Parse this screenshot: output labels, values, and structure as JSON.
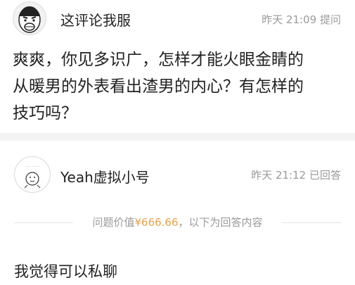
{
  "question": {
    "avatar_icon": "rage-face-avatar-icon",
    "username": "这评论我服",
    "time": "昨天 21:09",
    "action": "提问",
    "lines": [
      "爽爽，你见多识广，怎样才能火眼金睛的",
      "从暖男的外表看出渣男的内心？有怎样的",
      "技巧吗？"
    ]
  },
  "answer": {
    "avatar_icon": "cartoon-character-avatar-icon",
    "username": "Yeah虚拟小号",
    "time": "昨天 21:12",
    "action": "已回答",
    "price_prefix": "问题价值",
    "price": "¥666.66",
    "price_suffix": "，以下为回答内容",
    "text": "我觉得可以私聊"
  },
  "colors": {
    "text": "#222222",
    "muted": "#9a9a9a",
    "price": "#e8a14a",
    "separator": "#f3f3f3"
  }
}
